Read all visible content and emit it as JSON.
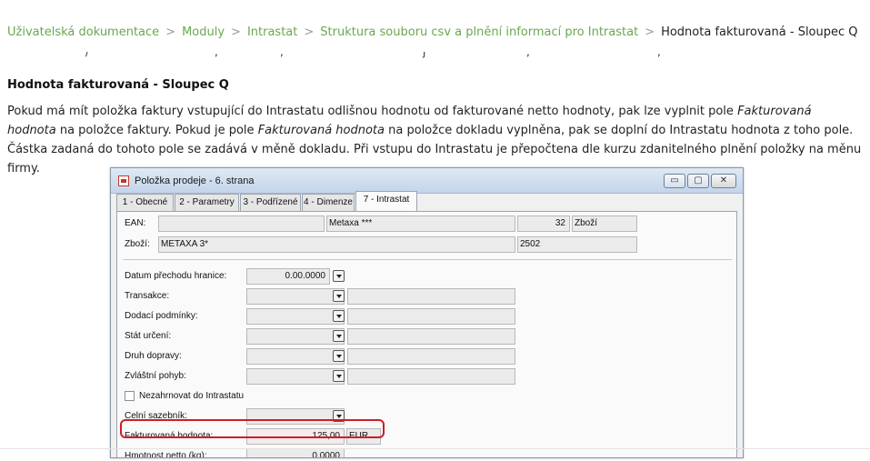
{
  "breadcrumb": {
    "items": [
      "Uživatelská dokumentace",
      "Moduly",
      "Intrastat",
      "Struktura souboru csv a plnění informací pro Intrastat"
    ],
    "separator": ">",
    "current": "Hodnota fakturovaná - Sloupec Q"
  },
  "page": {
    "title": "Hodnota fakturovaná - Sloupec Q",
    "para": {
      "t1": "Pokud má mít položka faktury vstupující do Intrastatu odlišnou hodnotu od fakturované netto hodnoty, pak lze vyplnit pole ",
      "em1": "Fakturovaná hodnota",
      "t2": " na položce faktury. Pokud je pole ",
      "em2": "Fakturovaná hodnota",
      "t3": " na položce dokladu vyplněna, pak se doplní do Intrastatu hodnota z toho pole. Částka zadaná do tohoto pole se zadává v měně dokladu. Při vstupu do Intrastatu je přepočtena dle kurzu zdanitelného plnění položky na měnu firmy."
    }
  },
  "dialog": {
    "title": "Položka prodeje - 6. strana",
    "window_buttons": {
      "minimize": "▭",
      "maximize": "▢",
      "close": "✕"
    },
    "tabs": [
      "1 - Obecné",
      "2 - Parametry",
      "3 - Podřízené",
      "4 - Dimenze",
      "7 - Intrastat"
    ],
    "active_tab": 4,
    "header": {
      "ean_label": "EAN:",
      "ean_value": "",
      "ean_name": "Metaxa ***",
      "qty": "32",
      "type": "Zboží",
      "item_label": "Zboží:",
      "item_value": "METAXA 3*",
      "item_code": "2502"
    },
    "fields": {
      "border_date_label": "Datum přechodu hranice:",
      "border_date_value": "0.00.0000",
      "transaction_label": "Transakce:",
      "delivery_label": "Dodací podmínky:",
      "state_label": "Stát určení:",
      "transport_label": "Druh dopravy:",
      "movement_label": "Zvláštní pohyb:",
      "exclude_label": "Nezahrnovat do Intrastatu",
      "exclude_checked": false,
      "tariff_label": "Celní sazebník:",
      "invoiced_label": "Fakturovaná hodnota:",
      "invoiced_value": "125,00",
      "invoiced_currency": "EUR",
      "net_weight_label": "Hmotnost netto (kg):",
      "net_weight_value": "0,0000"
    }
  },
  "colors": {
    "link": "#6aa84f",
    "highlight": "#d01d25"
  }
}
